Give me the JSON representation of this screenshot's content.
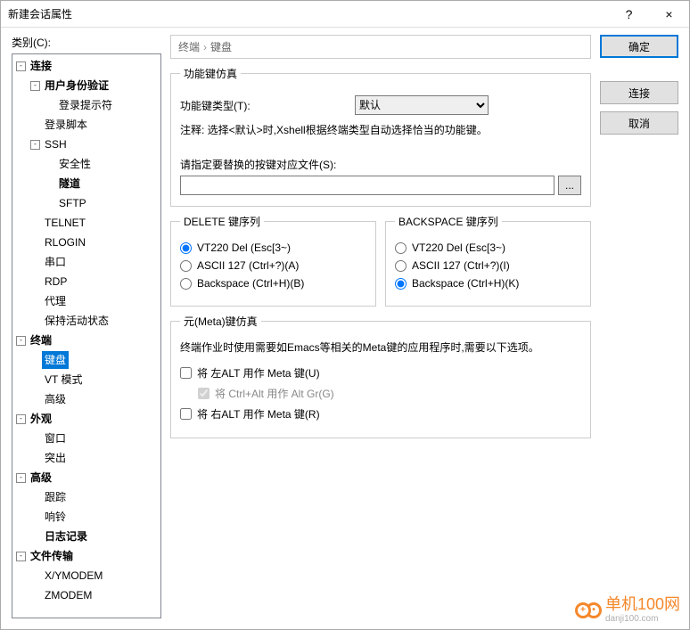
{
  "window": {
    "title": "新建会话属性",
    "help": "?",
    "close": "×"
  },
  "category_label": "类别(C):",
  "tree": {
    "connection": "连接",
    "auth": "用户身份验证",
    "loginprompt": "登录提示符",
    "loginscript": "登录脚本",
    "ssh": "SSH",
    "security": "安全性",
    "tunnel": "隧道",
    "sftp": "SFTP",
    "telnet": "TELNET",
    "rlogin": "RLOGIN",
    "serial": "串口",
    "rdp": "RDP",
    "proxy": "代理",
    "keepalive": "保持活动状态",
    "terminal": "终端",
    "keyboard": "键盘",
    "vtmode": "VT 模式",
    "advanced_t": "高级",
    "appearance": "外观",
    "window": "窗口",
    "highlight": "突出",
    "advanced": "高级",
    "trace": "跟踪",
    "bell": "响铃",
    "logging": "日志记录",
    "filetransfer": "文件传输",
    "xymodem": "X/YMODEM",
    "zmodem": "ZMODEM"
  },
  "breadcrumb": {
    "a": "终端",
    "b": "键盘"
  },
  "fkey": {
    "legend": "功能键仿真",
    "type_label": "功能键类型(T):",
    "type_value": "默认",
    "note": "注释: 选择<默认>时,Xshell根据终端类型自动选择恰当的功能键。",
    "file_label": "请指定要替换的按键对应文件(S):",
    "browse": "..."
  },
  "del": {
    "legend": "DELETE 键序列",
    "o1": "VT220 Del (Esc[3~)",
    "o2": "ASCII 127 (Ctrl+?)(A)",
    "o3": "Backspace (Ctrl+H)(B)"
  },
  "bksp": {
    "legend": "BACKSPACE 键序列",
    "o1": "VT220 Del (Esc[3~)",
    "o2": "ASCII 127 (Ctrl+?)(I)",
    "o3": "Backspace (Ctrl+H)(K)"
  },
  "meta": {
    "legend": "元(Meta)键仿真",
    "desc": "终端作业时使用需要如Emacs等相关的Meta键的应用程序时,需要以下选项。",
    "c1": "将 左ALT 用作 Meta 键(U)",
    "c2": "将 Ctrl+Alt 用作 Alt Gr(G)",
    "c3": "将 右ALT 用作 Meta 键(R)"
  },
  "buttons": {
    "ok": "确定",
    "connect": "连接",
    "cancel": "取消"
  },
  "watermark": {
    "brand": "单机100网",
    "url": "danji100.com"
  }
}
